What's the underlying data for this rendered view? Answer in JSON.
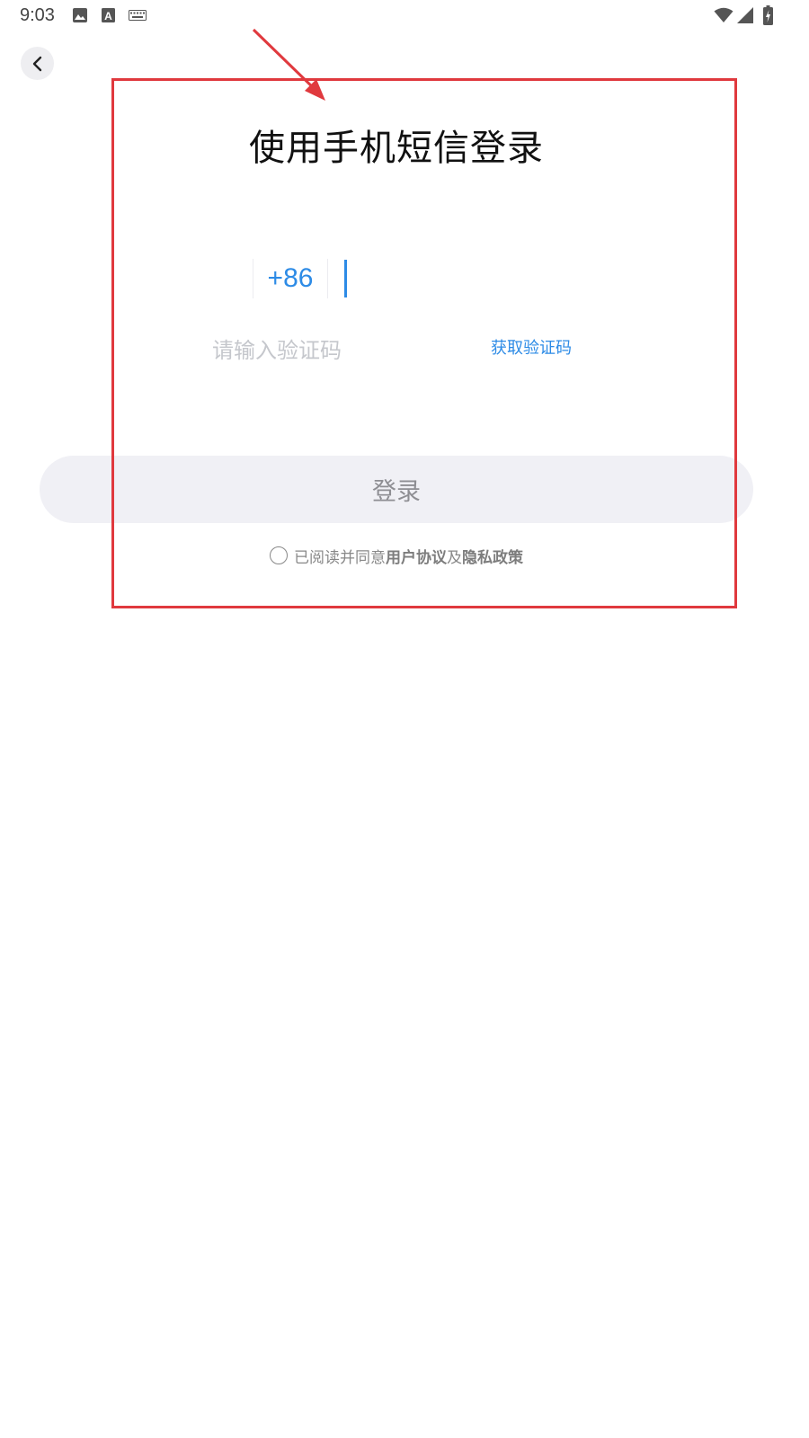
{
  "status_bar": {
    "time": "9:03",
    "left_icons": [
      "image-icon",
      "text-a-icon",
      "keyboard-icon"
    ],
    "right_icons": [
      "wifi-icon",
      "signal-icon",
      "battery-charging-icon"
    ]
  },
  "header": {
    "back_icon": "chevron-left-icon"
  },
  "main": {
    "title": "使用手机短信登录",
    "country_code": "+86",
    "phone_value": "",
    "code_placeholder": "请输入验证码",
    "get_code_label": "获取验证码",
    "login_label": "登录",
    "agreement": {
      "prefix": "已阅读并同意",
      "user_agreement": "用户协议",
      "conjunction": "及",
      "privacy_policy": "隐私政策",
      "checked": false
    }
  },
  "colors": {
    "accent": "#2d8be6",
    "annotation": "#e0393e",
    "button_bg": "#f0f0f5",
    "placeholder": "#c5c7cc"
  }
}
